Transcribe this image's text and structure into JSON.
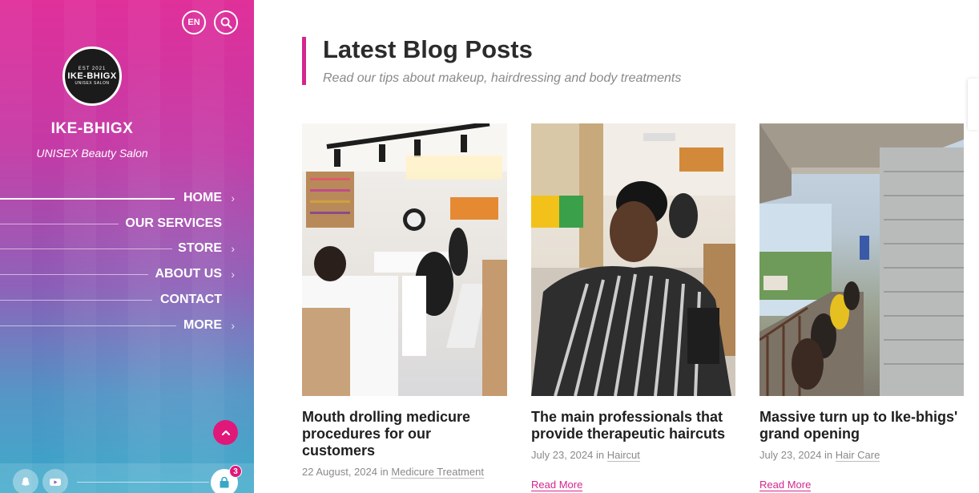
{
  "sidebar": {
    "lang_label": "EN",
    "logo": {
      "top": "EST 2021",
      "main": "IKE-BHIGX",
      "sub": "UNISEX SALON"
    },
    "brand_name": "IKE-BHIGX",
    "brand_tagline": "UNISEX Beauty Salon",
    "nav": [
      {
        "label": "HOME",
        "chevron": "›"
      },
      {
        "label": "OUR SERVICES",
        "chevron": ""
      },
      {
        "label": "STORE",
        "chevron": "›"
      },
      {
        "label": "ABOUT US",
        "chevron": "›"
      },
      {
        "label": "CONTACT",
        "chevron": ""
      },
      {
        "label": "MORE",
        "chevron": "›"
      }
    ],
    "cart_count": "3",
    "accent_color": "#e0187a"
  },
  "main": {
    "title": "Latest Blog Posts",
    "subtitle": "Read our tips about makeup, hairdressing and body treatments",
    "posts": [
      {
        "title": "Mouth drolling medicure procedures for our customers",
        "date": "22 August, 2024",
        "in": "in",
        "category": "Medicure Treatment",
        "read_more": ""
      },
      {
        "title": "The main professionals that provide therapeutic haircuts",
        "date": "July 23, 2024",
        "in": "in",
        "category": "Haircut",
        "read_more": "Read More"
      },
      {
        "title": "Massive turn up to Ike-bhigs' grand opening",
        "date": "July 23, 2024",
        "in": "in",
        "category": "Hair Care",
        "read_more": "Read More"
      }
    ]
  }
}
